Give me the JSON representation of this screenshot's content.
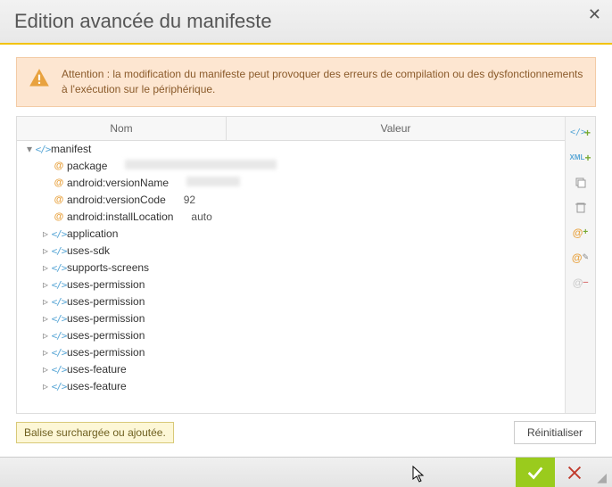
{
  "title": "Edition avancée du manifeste",
  "warning_text": "Attention : la modification du manifeste peut provoquer des erreurs de compilation ou des dysfonctionnements à l'exécution sur le périphérique.",
  "columns": {
    "name": "Nom",
    "value": "Valeur"
  },
  "tree": {
    "root": "manifest",
    "attrs": [
      {
        "name": "package",
        "value": "",
        "obscured": true,
        "obscured_width": 170
      },
      {
        "name": "android:versionName",
        "value": "",
        "obscured": true,
        "obscured_width": 60
      },
      {
        "name": "android:versionCode",
        "value": "92"
      },
      {
        "name": "android:installLocation",
        "value": "auto"
      }
    ],
    "children": [
      "application",
      "uses-sdk",
      "supports-screens",
      "uses-permission",
      "uses-permission",
      "uses-permission",
      "uses-permission",
      "uses-permission",
      "uses-feature",
      "uses-feature"
    ]
  },
  "toolbar_icons": [
    "tag-plus",
    "xml-plus",
    "copy",
    "delete",
    "at-plus",
    "at-edit",
    "at-remove"
  ],
  "legend": "Balise surchargée ou ajoutée.",
  "reset_label": "Réinitialiser"
}
